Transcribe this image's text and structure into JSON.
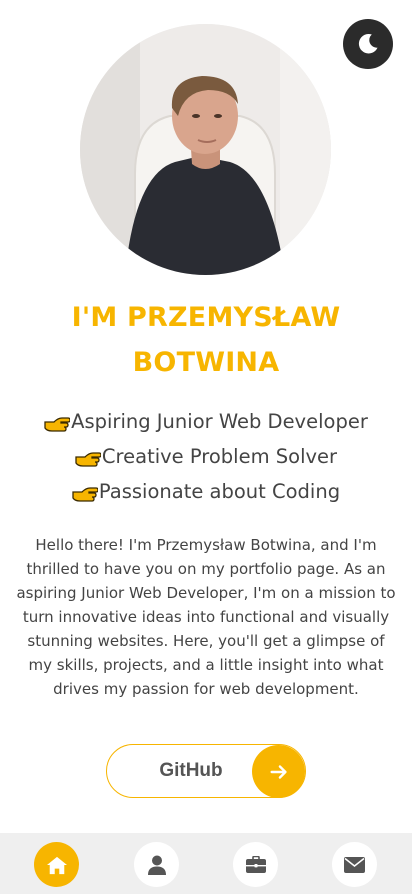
{
  "header": {
    "theme_toggle_icon": "moon-icon"
  },
  "profile": {
    "title_line1": "I'M PRZEMYSŁAW",
    "title_line2": "BOTWINA",
    "roles": [
      "Aspiring Junior Web Developer",
      "Creative Problem Solver",
      "Passionate about Coding"
    ],
    "role_icon": "pointing-hand-icon",
    "bio": "Hello there! I'm Przemysław Botwina, and I'm thrilled to have you on my portfolio page. As an aspiring Junior Web Developer, I'm on a mission to turn innovative ideas into functional and visually stunning websites. Here, you'll get a glimpse of my skills, projects, and a little insight into what drives my passion for web development."
  },
  "github_button": {
    "label": "GitHub",
    "icon": "arrow-right-icon"
  },
  "nav": {
    "items": [
      {
        "icon": "home-icon",
        "active": true
      },
      {
        "icon": "user-icon",
        "active": false
      },
      {
        "icon": "briefcase-icon",
        "active": false
      },
      {
        "icon": "envelope-icon",
        "active": false
      }
    ]
  },
  "colors": {
    "accent": "#f7b500",
    "dark": "#2b2b2b",
    "text": "#444444",
    "nav_background": "#efefef"
  }
}
